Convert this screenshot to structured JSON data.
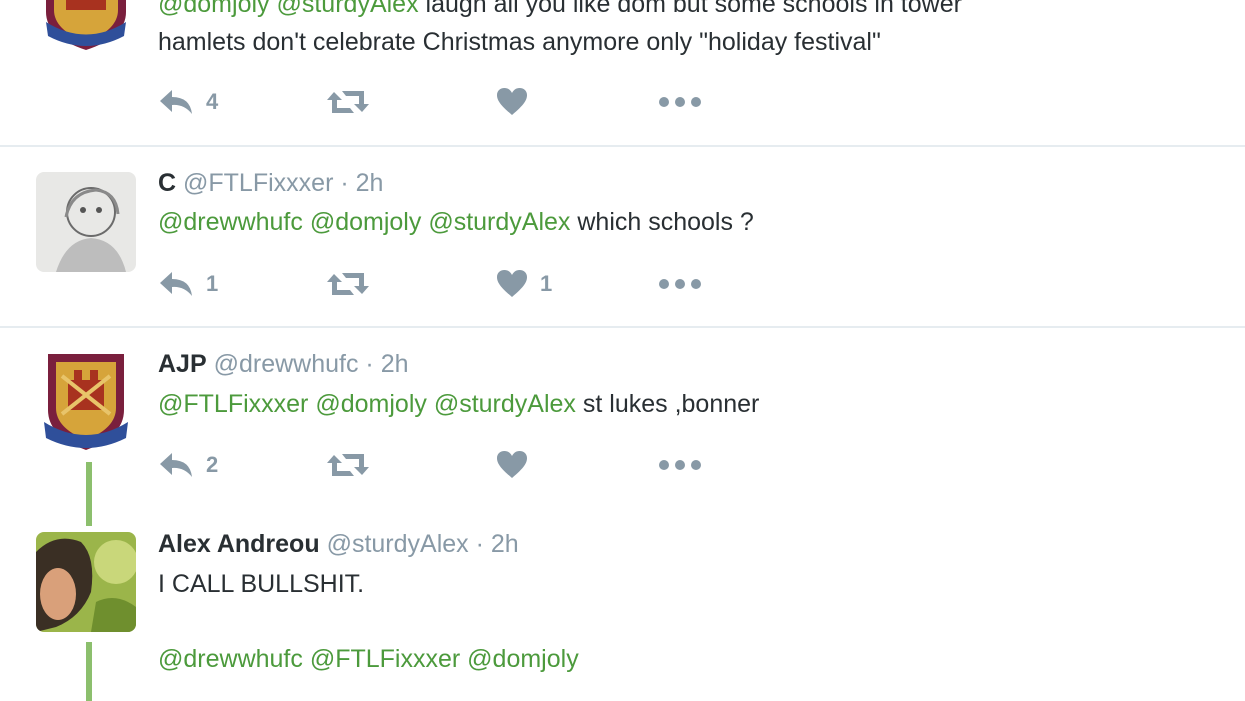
{
  "colors": {
    "mention": "#4c9a3c",
    "muted": "#8899a6",
    "text": "#292f33",
    "thread": "#8cbf6d",
    "divider": "#e6ecf0"
  },
  "tweets": [
    {
      "name": "",
      "handle": "",
      "time": "",
      "line1": {
        "mentions": [
          "@domjoly",
          "@sturdyAlex"
        ],
        "text": "laugh all you like dom but some schools in tower"
      },
      "line2": "hamlets don't celebrate Christmas anymore only \"holiday festival\"",
      "actions": {
        "reply": "4",
        "retweet": "",
        "like": ""
      },
      "avatar": "west-ham-crest"
    },
    {
      "name": "C",
      "handle": "@FTLFixxxer",
      "dot": "·",
      "time": "2h",
      "line1": {
        "mentions": [
          "@drewwhufc",
          "@domjoly",
          "@sturdyAlex"
        ],
        "text": "which schools ?"
      },
      "actions": {
        "reply": "1",
        "retweet": "",
        "like": "1"
      },
      "avatar": "sketch-portrait"
    },
    {
      "name": "AJP",
      "handle": "@drewwhufc",
      "dot": "·",
      "time": "2h",
      "line1": {
        "mentions": [
          "@FTLFixxxer",
          "@domjoly",
          "@sturdyAlex"
        ],
        "text": "st lukes ,bonner"
      },
      "actions": {
        "reply": "2",
        "retweet": "",
        "like": ""
      },
      "avatar": "west-ham-crest"
    },
    {
      "name": "Alex Andreou",
      "handle": "@sturdyAlex",
      "dot": "·",
      "time": "2h",
      "line1": {
        "mentions": [],
        "text": "I CALL BULLSHIT."
      },
      "line2": {
        "mentions": [
          "@drewwhufc",
          "@FTLFixxxer",
          "@domjoly"
        ]
      },
      "avatar": "photo-portrait"
    }
  ]
}
